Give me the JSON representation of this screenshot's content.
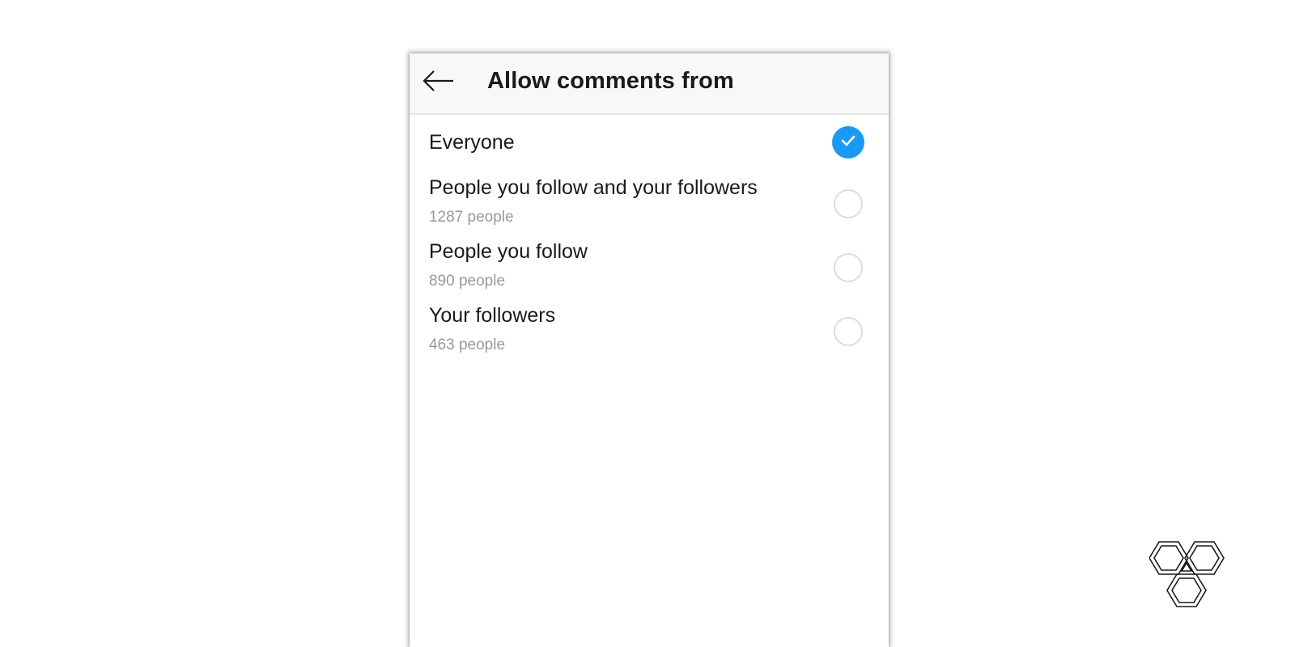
{
  "header": {
    "title": "Allow comments from",
    "back_icon": "arrow-left-icon"
  },
  "options": [
    {
      "label": "Everyone",
      "sub": "",
      "selected": true
    },
    {
      "label": "People you follow and your followers",
      "sub": "1287 people",
      "selected": false
    },
    {
      "label": "People you follow",
      "sub": "890 people",
      "selected": false
    },
    {
      "label": "Your followers",
      "sub": "463 people",
      "selected": false
    }
  ],
  "colors": {
    "accent": "#1a9af5",
    "header_bg": "#f8f8f8",
    "secondary_text": "#999999"
  },
  "watermark_icon": "hexagon-logo-icon"
}
